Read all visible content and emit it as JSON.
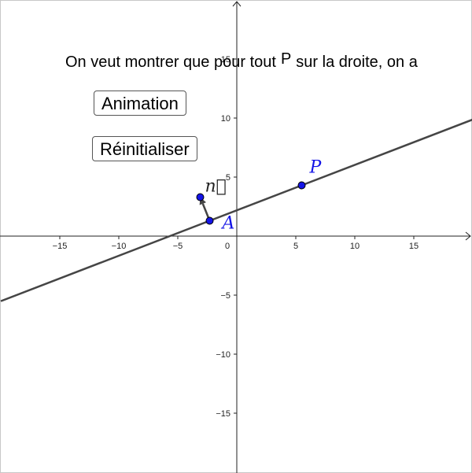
{
  "statement": {
    "before": "On veut montrer que pour tout",
    "variable": "P",
    "after": "sur la droite, on a"
  },
  "buttons": {
    "animation": "Animation",
    "reset": "Réinitialiser"
  },
  "chart_data": {
    "type": "scatter",
    "title": "",
    "xlabel": "",
    "ylabel": "",
    "xlim": [
      -20,
      20
    ],
    "ylim": [
      -20,
      20
    ],
    "x_ticks": [
      -15,
      -10,
      -5,
      0,
      5,
      10,
      15
    ],
    "y_ticks": [
      -15,
      -10,
      -5,
      5,
      10,
      15
    ],
    "grid": false,
    "line": {
      "through": [
        [
          -2.3,
          1.3
        ],
        [
          5.5,
          4.3
        ]
      ]
    },
    "points": [
      {
        "name": "A",
        "x": -2.3,
        "y": 1.3
      },
      {
        "name": "P",
        "x": 5.5,
        "y": 4.3
      },
      {
        "name": "",
        "x": -3.1,
        "y": 3.3
      }
    ],
    "vector": {
      "label": "n⃗",
      "from": [
        -2.3,
        1.3
      ],
      "to": [
        -3.1,
        3.3
      ]
    },
    "colors": {
      "point": "#1414e6",
      "line": "#454545",
      "axis": "#222222",
      "label": "#1414e6"
    }
  }
}
